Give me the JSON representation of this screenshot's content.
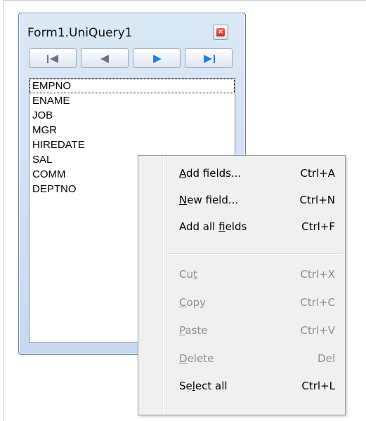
{
  "window": {
    "title": "Form1.UniQuery1",
    "close_icon": "close-icon"
  },
  "navigator": {
    "buttons": [
      {
        "name": "first",
        "icon": "first-record-icon",
        "color": "#6b7280"
      },
      {
        "name": "prior",
        "icon": "previous-record-icon",
        "color": "#6b7280"
      },
      {
        "name": "next",
        "icon": "next-record-icon",
        "color": "#2a7de1"
      },
      {
        "name": "last",
        "icon": "last-record-icon",
        "color": "#2a7de1"
      }
    ]
  },
  "fields": [
    "EMPNO",
    "ENAME",
    "JOB",
    "MGR",
    "HIREDATE",
    "SAL",
    "COMM",
    "DEPTNO"
  ],
  "context_menu": {
    "items": [
      {
        "label": "Add fields...",
        "accel": "A",
        "shortcut": "Ctrl+A",
        "enabled": true
      },
      {
        "label": "New field...",
        "accel": "N",
        "shortcut": "Ctrl+N",
        "enabled": true
      },
      {
        "label": "Add all fields",
        "accel": "f",
        "shortcut": "Ctrl+F",
        "enabled": true
      },
      {
        "label": "Cut",
        "accel": "t",
        "shortcut": "Ctrl+X",
        "enabled": false
      },
      {
        "label": "Copy",
        "accel": "C",
        "shortcut": "Ctrl+C",
        "enabled": false
      },
      {
        "label": "Paste",
        "accel": "P",
        "shortcut": "Ctrl+V",
        "enabled": false
      },
      {
        "label": "Delete",
        "accel": "D",
        "shortcut": "Del",
        "enabled": false
      },
      {
        "label": "Select all",
        "accel": "l",
        "shortcut": "Ctrl+L",
        "enabled": true
      }
    ]
  },
  "colors": {
    "menu_enabled": "#000000",
    "menu_disabled": "#8d8d8d",
    "window_border": "#6b7f99"
  }
}
